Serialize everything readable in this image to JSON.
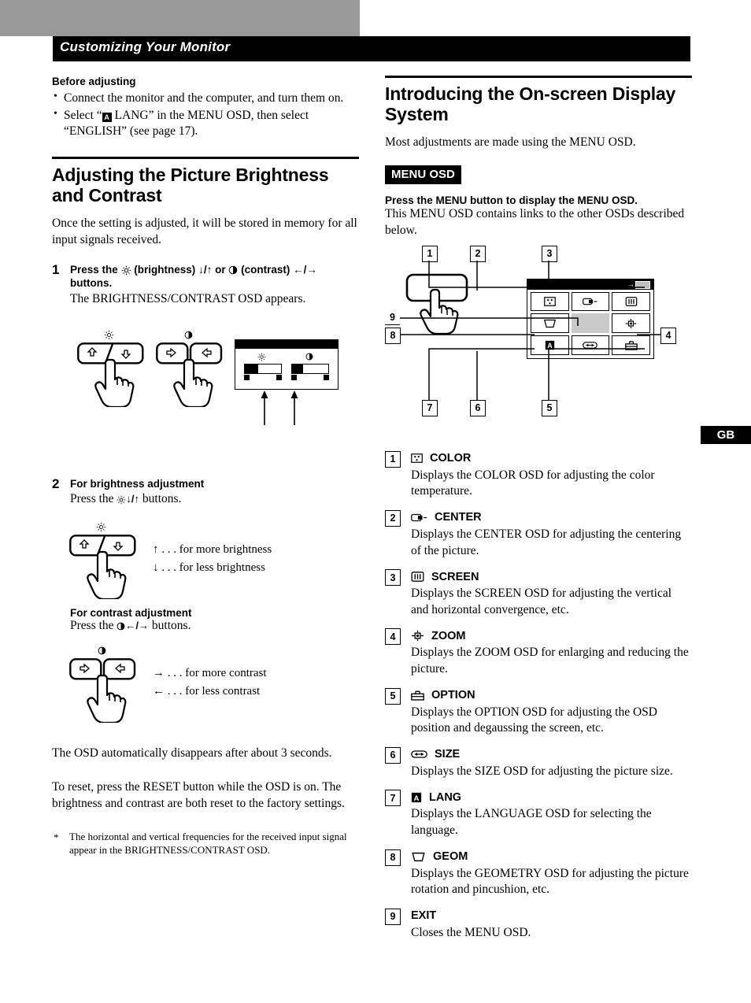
{
  "header": {
    "title": "Customizing Your Monitor"
  },
  "left": {
    "before_adjusting": {
      "heading": "Before adjusting",
      "bullets": [
        "Connect the monitor and the computer, and turn them on.",
        "Select “ LANG” in the MENU OSD, then select “ENGLISH” (see page 17)."
      ],
      "bullet2_part1": "Select “",
      "bullet2_icon": "A",
      "bullet2_part2": " LANG” in the MENU OSD, then select",
      "bullet2_line2": "“ENGLISH” (see page 17)."
    },
    "section_title": "Adjusting the Picture Brightness and Contrast",
    "intro": "Once the setting is adjusted, it will be stored in memory for all input signals received.",
    "step1": {
      "number": "1",
      "headline_pre": "Press  the ",
      "headline_brightness_icon": "brightness-icon",
      "headline_mid1": " (brightness) ",
      "headline_arrows1": "↓/↑",
      "headline_mid2": " or ",
      "headline_contrast_icon": "contrast-icon",
      "headline_mid3": " (contrast) ",
      "headline_arrows2": "←/→",
      "headline_end": " buttons.",
      "body": "The BRIGHTNESS/CONTRAST OSD appears."
    },
    "step2": {
      "number": "2",
      "brightness_heading": "For brightness adjustment",
      "brightness_body_pre": "Press the ",
      "brightness_body_arrows": "↓/↑",
      "brightness_body_post": " buttons.",
      "brightness_legend": [
        {
          "arrow": "↑",
          "text": ". . . for more brightness"
        },
        {
          "arrow": "↓",
          "text": ". . . for less brightness"
        }
      ],
      "contrast_heading": "For contrast adjustment",
      "contrast_body_pre": "Press the ",
      "contrast_body_arrows": "←/→",
      "contrast_body_post": " buttons.",
      "contrast_legend": [
        {
          "arrow": "→",
          "text": ". . . for more contrast"
        },
        {
          "arrow": "←",
          "text": ". . . for less contrast"
        }
      ]
    },
    "note_auto": "The OSD automatically disappears after about 3 seconds.",
    "note_reset": "To reset,  press the RESET button while the OSD is on. The brightness and contrast are both reset to the factory settings.",
    "footnote": {
      "marker": "*",
      "text": "The horizontal and vertical frequencies for the received input signal appear in the BRIGHTNESS/CONTRAST OSD."
    }
  },
  "right": {
    "section_title": "Introducing the On-screen Display System",
    "intro": "Most adjustments are made using the MENU OSD.",
    "menu_osd_tag": "MENU OSD",
    "bold_line": "Press the MENU button to display the MENU OSD.",
    "body": "This MENU OSD contains links to the other OSDs described below.",
    "diagram": {
      "callouts": [
        "1",
        "2",
        "3",
        "4",
        "5",
        "6",
        "7",
        "8",
        "9"
      ],
      "cells": [
        {
          "icon": "color-icon",
          "callout": "1"
        },
        {
          "icon": "center-icon",
          "callout": "2"
        },
        {
          "icon": "screen-icon",
          "callout": "3"
        },
        {
          "icon": "geom-icon",
          "callout": "8"
        },
        {
          "icon": "exit-highlight",
          "callout": "9"
        },
        {
          "icon": "zoom-icon",
          "callout": "4"
        },
        {
          "icon": "lang-icon",
          "callout": "7"
        },
        {
          "icon": "size-icon",
          "callout": "6"
        },
        {
          "icon": "option-icon",
          "callout": "5"
        }
      ]
    },
    "items": [
      {
        "num": "1",
        "icon": "color-icon",
        "label": "COLOR",
        "desc": "Displays the COLOR OSD for adjusting the color temperature."
      },
      {
        "num": "2",
        "icon": "center-icon",
        "label": "CENTER",
        "desc": "Displays the CENTER OSD for adjusting the centering of the picture."
      },
      {
        "num": "3",
        "icon": "screen-icon",
        "label": "SCREEN",
        "desc": "Displays the SCREEN OSD for adjusting the vertical and horizontal convergence, etc."
      },
      {
        "num": "4",
        "icon": "zoom-icon",
        "label": "ZOOM",
        "desc": "Displays the ZOOM OSD for enlarging and reducing the picture."
      },
      {
        "num": "5",
        "icon": "option-icon",
        "label": "OPTION",
        "desc": "Displays the OPTION OSD for adjusting the OSD position and degaussing the screen, etc."
      },
      {
        "num": "6",
        "icon": "size-icon",
        "label": "SIZE",
        "desc": "Displays the SIZE OSD for adjusting the picture size."
      },
      {
        "num": "7",
        "icon": "lang-icon",
        "label": "LANG",
        "desc": "Displays the LANGUAGE OSD for selecting the language."
      },
      {
        "num": "8",
        "icon": "geom-icon",
        "label": "GEOM",
        "desc": "Displays the GEOMETRY OSD for adjusting the picture rotation and pincushion, etc."
      },
      {
        "num": "9",
        "icon": "",
        "label": "EXIT",
        "desc": "Closes the MENU OSD."
      }
    ]
  },
  "page_badge": "GB",
  "colors": {
    "gray_block": "#999999",
    "ink": "#000000",
    "selection": "#c9c9c9"
  }
}
